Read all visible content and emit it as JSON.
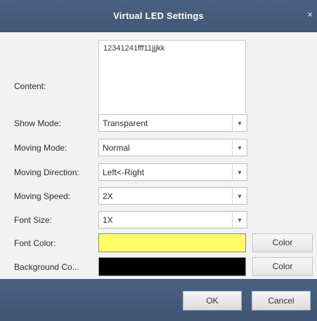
{
  "dialog": {
    "title": "Virtual LED Settings",
    "close_glyph": "×"
  },
  "content": {
    "label": "Content:",
    "value": "12341241fff11jjjkk"
  },
  "show_mode": {
    "label": "Show Mode:",
    "value": "Transparent"
  },
  "moving_mode": {
    "label": "Moving Mode:",
    "value": "Normal"
  },
  "moving_direction": {
    "label": "Moving Direction:",
    "value": "Left<-Right"
  },
  "moving_speed": {
    "label": "Moving Speed:",
    "value": "2X"
  },
  "font_size": {
    "label": "Font Size:",
    "value": "1X"
  },
  "font_color": {
    "label": "Font Color:",
    "swatch": "#ffff66",
    "button": "Color"
  },
  "background_color": {
    "label": "Background Co...",
    "swatch": "#000000",
    "button": "Color"
  },
  "footer": {
    "ok_label": "OK",
    "cancel_label": "Cancel"
  },
  "icons": {
    "dropdown": "chevron-down-icon",
    "close": "close-icon"
  },
  "colors": {
    "titlebar": "#45597a",
    "body": "#f2f2f2"
  }
}
